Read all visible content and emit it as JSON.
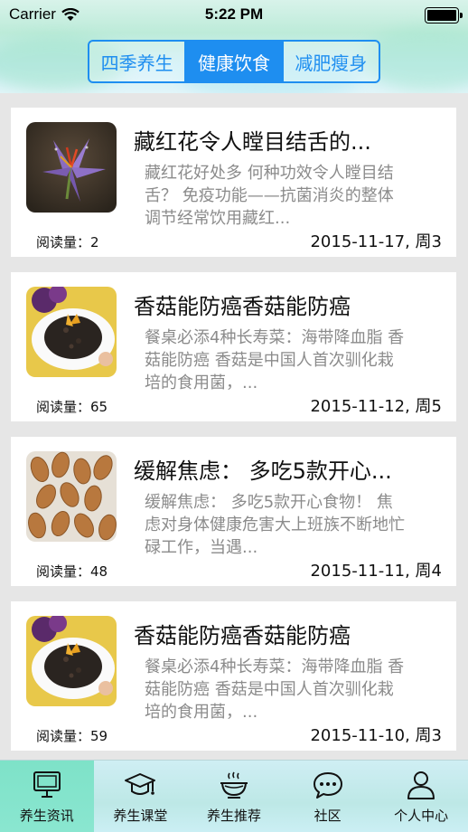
{
  "status_bar": {
    "carrier": "Carrier",
    "time": "5:22 PM"
  },
  "segments": [
    {
      "label": "四季养生",
      "active": false
    },
    {
      "label": "健康饮食",
      "active": true
    },
    {
      "label": "减肥瘦身",
      "active": false
    }
  ],
  "articles": [
    {
      "title": "藏红花令人瞠目结舌的...",
      "description": "藏红花好处多 何种功效令人瞠目结舌？ 免疫功能——抗菌消炎的整体调节经常饮用藏红...",
      "reads": "阅读量：2",
      "date": "2015-11-17, 周3",
      "image": "saffron-flower-image"
    },
    {
      "title": "香菇能防癌香菇能防癌",
      "description": "餐桌必添4种长寿菜：海带降血脂 香菇能防癌 香菇是中国人首次驯化栽培的食用菌，...",
      "reads": "阅读量：65",
      "date": "2015-11-12, 周5",
      "image": "mushroom-dish-image"
    },
    {
      "title": "缓解焦虑： 多吃5款开心...",
      "description": "缓解焦虑： 多吃5款开心食物！ 焦虑对身体健康危害大上班族不断地忙碌工作，当遇...",
      "reads": "阅读量：48",
      "date": "2015-11-11, 周4",
      "image": "almonds-image"
    },
    {
      "title": "香菇能防癌香菇能防癌",
      "description": "餐桌必添4种长寿菜：海带降血脂 香菇能防癌 香菇是中国人首次驯化栽培的食用菌，...",
      "reads": "阅读量：59",
      "date": "2015-11-10, 周3",
      "image": "mushroom-dish-image"
    }
  ],
  "tabbar": [
    {
      "label": "养生资讯",
      "icon": "monitor-icon",
      "active": true
    },
    {
      "label": "养生课堂",
      "icon": "graduation-cap-icon",
      "active": false
    },
    {
      "label": "养生推荐",
      "icon": "food-bowl-icon",
      "active": false
    },
    {
      "label": "社区",
      "icon": "chat-bubble-icon",
      "active": false
    },
    {
      "label": "个人中心",
      "icon": "person-icon",
      "active": false
    }
  ],
  "colors": {
    "accent": "#1e8ef0",
    "tab_active": "#7ee2c8"
  }
}
